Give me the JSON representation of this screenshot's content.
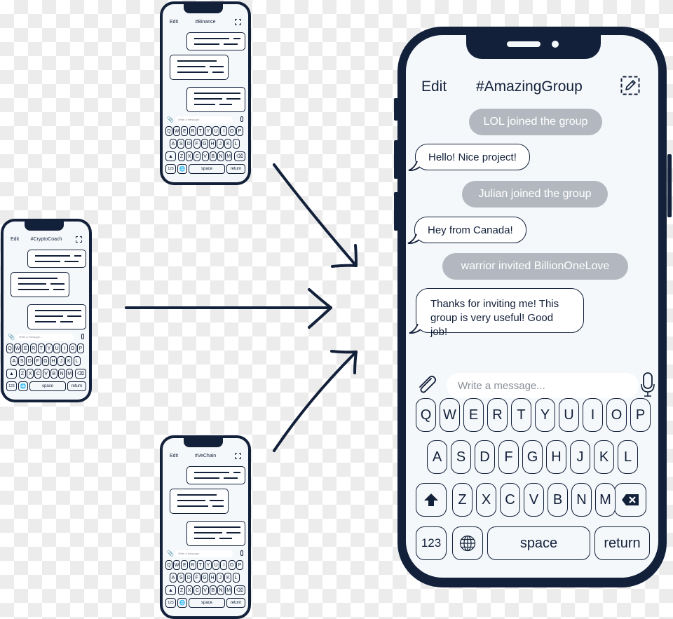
{
  "colors": {
    "frame": "#12203a",
    "screen": "#f5f8fa",
    "system_message_bg": "#b3b8c0",
    "system_message_text": "#ffffff",
    "placeholder": "#8a8f98"
  },
  "main_phone": {
    "header": {
      "edit_label": "Edit",
      "title": "#AmazingGroup",
      "compose_icon": "compose-icon"
    },
    "messages": [
      {
        "type": "system",
        "text": "LOL joined the group"
      },
      {
        "type": "incoming",
        "text": "Hello! Nice project!"
      },
      {
        "type": "system",
        "text": "Julian joined the group"
      },
      {
        "type": "incoming",
        "text": "Hey from Canada!"
      },
      {
        "type": "system",
        "text": "warrior invited BillionOneLove"
      },
      {
        "type": "incoming",
        "lines": [
          "Thanks for inviting me! This",
          "group is very useful! Good job!"
        ]
      }
    ],
    "input": {
      "placeholder": "Write a message...",
      "value": "",
      "attach_icon": "paperclip-icon",
      "mic_icon": "microphone-icon"
    },
    "keyboard": {
      "row1": [
        "Q",
        "W",
        "E",
        "R",
        "T",
        "Y",
        "U",
        "I",
        "O",
        "P"
      ],
      "row2": [
        "A",
        "S",
        "D",
        "F",
        "G",
        "H",
        "J",
        "K",
        "L"
      ],
      "row3": [
        "Z",
        "X",
        "C",
        "V",
        "B",
        "N",
        "M"
      ],
      "shift_icon": "shift-arrow-icon",
      "backspace_icon": "backspace-icon",
      "numbers_label": "123",
      "globe_icon": "globe-icon",
      "space_label": "space",
      "return_label": "return"
    }
  },
  "small_phones": [
    {
      "id": "binance",
      "edit_label": "Edit",
      "title": "#Binance",
      "placeholder": "Write a message..."
    },
    {
      "id": "cryptocoach",
      "edit_label": "Edit",
      "title": "#CryptoCoach",
      "placeholder": "Write a message..."
    },
    {
      "id": "vechain",
      "edit_label": "Edit",
      "title": "#VeChain",
      "placeholder": "Write a message..."
    }
  ],
  "small_keyboard": {
    "row1": [
      "Q",
      "W",
      "E",
      "R",
      "T",
      "Y",
      "U",
      "I",
      "O",
      "P"
    ],
    "row2": [
      "A",
      "S",
      "D",
      "F",
      "G",
      "H",
      "J",
      "K",
      "L"
    ],
    "row3": [
      "Z",
      "X",
      "C",
      "V",
      "B",
      "N",
      "M"
    ],
    "numbers_label": "123",
    "space_label": "space",
    "return_label": "return"
  },
  "arrows": [
    {
      "from": "binance",
      "to": "main_phone",
      "direction": "down-right"
    },
    {
      "from": "cryptocoach",
      "to": "main_phone",
      "direction": "right"
    },
    {
      "from": "vechain",
      "to": "main_phone",
      "direction": "up-right"
    }
  ]
}
